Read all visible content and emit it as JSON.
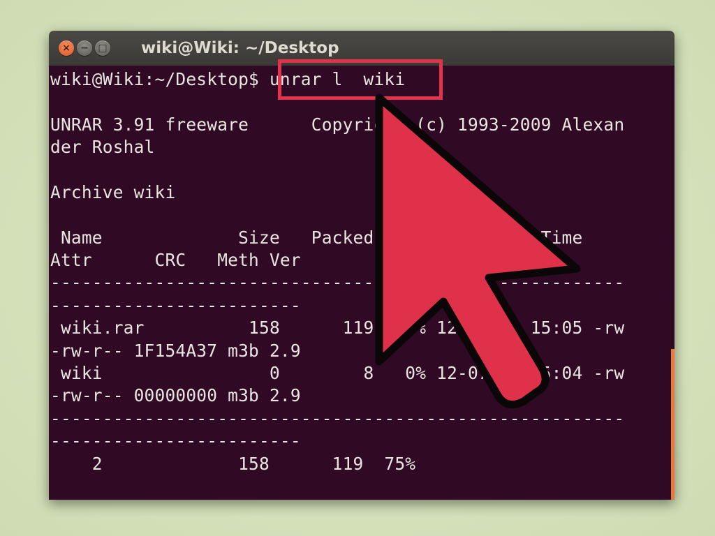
{
  "window": {
    "title": "wiki@Wiki: ~/Desktop",
    "close_glyph": "×",
    "minimize_glyph": "−",
    "maximize_glyph": "□"
  },
  "terminal": {
    "lines": [
      "wiki@Wiki:~/Desktop$ unrar l  wiki",
      "",
      "UNRAR 3.91 freeware      Copyright (c) 1993-2009 Alexan",
      "der Roshal",
      "",
      "Archive wiki",
      "",
      " Name             Size   Packed Ratio  Date    Time",
      "Attr      CRC   Meth Ver",
      "-------------------------------------------------------",
      "------------------------",
      " wiki.rar          158      119  70% 12-07-15 15:05 -rw",
      "-rw-r-- 1F154A37 m3b 2.9",
      " wiki                0        8   0% 12-07-15 15:04 -rw",
      "-rw-r-- 00000000 m3b 2.9",
      "-------------------------------------------------------",
      "------------------------",
      "    2             158      119  75%"
    ]
  },
  "colors": {
    "terminal_bg": "#300a24",
    "text": "#e9e6e2",
    "highlight": "#e3334a",
    "arrow_fill": "#e0314a",
    "scrollbar": "#e8793d"
  },
  "annotation": {
    "highlighted_text": "unrar l  wiki",
    "pointer": "big-red-arrow-icon"
  }
}
